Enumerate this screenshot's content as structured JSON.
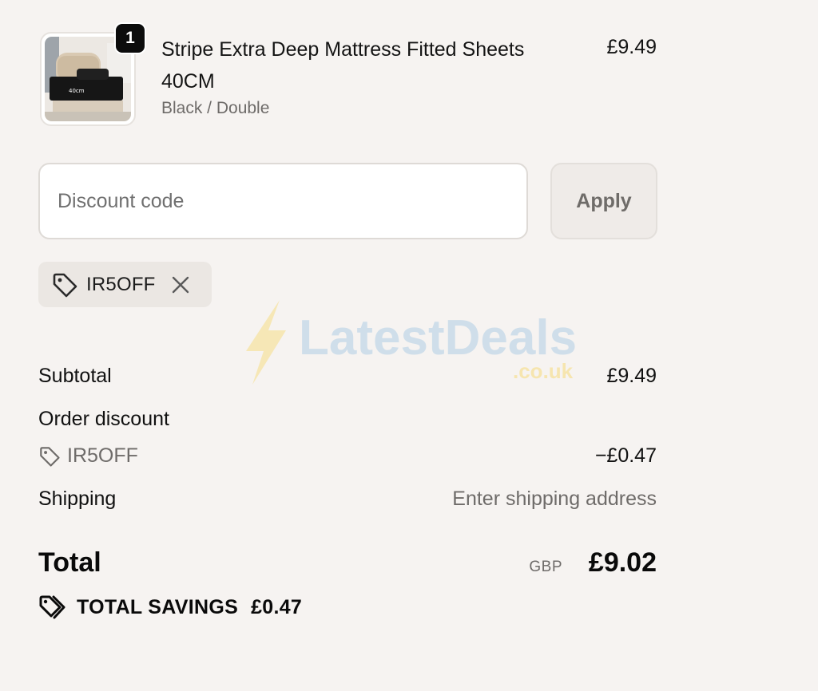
{
  "product": {
    "quantity_badge": "1",
    "title": "Stripe Extra Deep Mattress Fitted Sheets 40CM",
    "variant": "Black / Double",
    "price": "£9.49",
    "image_label": "40cm"
  },
  "discount": {
    "placeholder": "Discount code",
    "apply_label": "Apply",
    "applied_code": "IR5OFF"
  },
  "watermark": {
    "brand": "LatestDeals",
    "domain": ".co.uk"
  },
  "summary": {
    "subtotal_label": "Subtotal",
    "subtotal_value": "£9.49",
    "order_discount_label": "Order discount",
    "discount_code": "IR5OFF",
    "discount_value": "−£0.47",
    "shipping_label": "Shipping",
    "shipping_value": "Enter shipping address",
    "total_label": "Total",
    "currency": "GBP",
    "total_value": "£9.02",
    "savings_label": "TOTAL SAVINGS",
    "savings_value": "£0.47"
  },
  "colors": {
    "background": "#f6f3f1",
    "text_primary": "#111111",
    "text_secondary": "#6e6b69",
    "watermark_blue": "#c9dbe9",
    "watermark_yellow": "#f6e4a8"
  }
}
